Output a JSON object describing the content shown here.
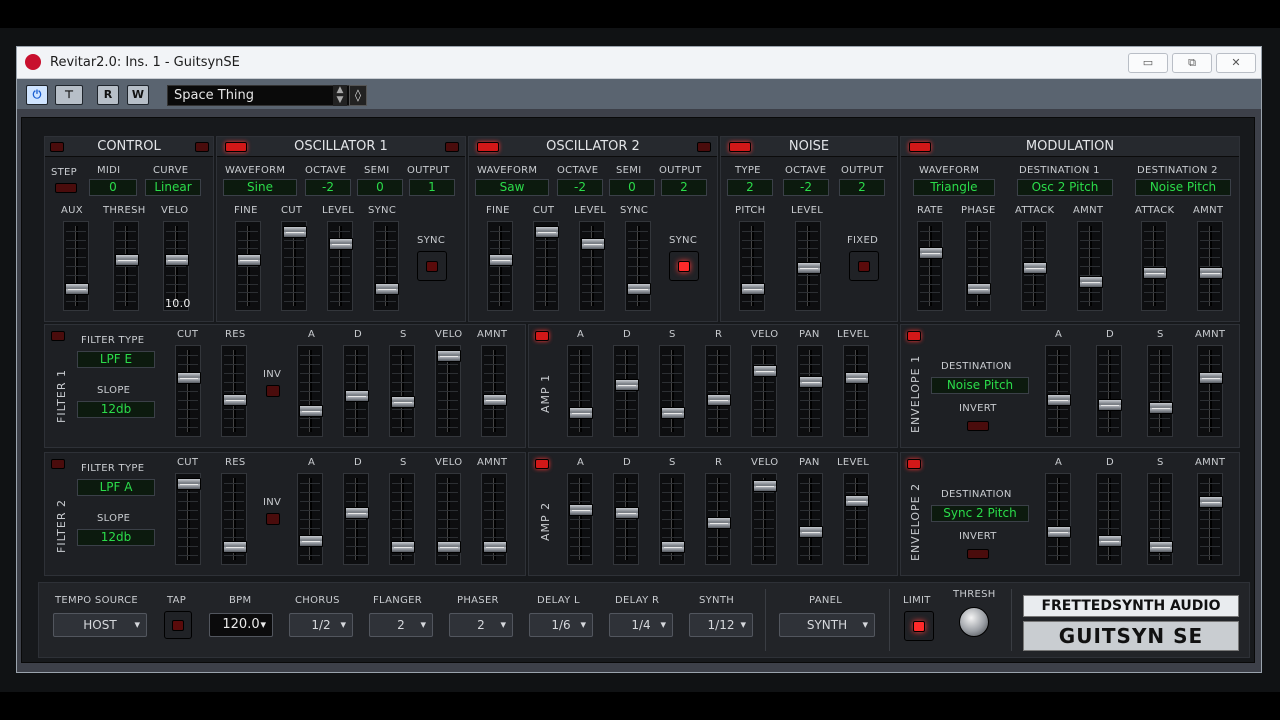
{
  "window": {
    "title": "Revitar2.0: Ins. 1 - GuitsynSE",
    "minimize": "▭",
    "restore": "⧉",
    "close": "✕"
  },
  "toolbar": {
    "power_icon": "power-icon",
    "monitor_icon": "monitor-icon",
    "read_label": "R",
    "write_label": "W",
    "preset": "Space Thing"
  },
  "control": {
    "title": "CONTROL",
    "step": "STEP",
    "midi": "MIDI",
    "curve": "CURVE",
    "midi_value": "0",
    "curve_value": "Linear",
    "aux": "AUX",
    "thresh": "THRESH",
    "velo": "VELO",
    "velo_readout": "10.0"
  },
  "osc1": {
    "title": "OSCILLATOR 1",
    "waveform": "WAVEFORM",
    "octave": "OCTAVE",
    "semi": "SEMI",
    "output": "OUTPUT",
    "waveform_value": "Sine",
    "octave_value": "-2",
    "semi_value": "0",
    "output_value": "1",
    "fine": "FINE",
    "cut": "CUT",
    "level": "LEVEL",
    "sync": "SYNC",
    "sync_btn": "SYNC"
  },
  "osc2": {
    "title": "OSCILLATOR 2",
    "waveform": "WAVEFORM",
    "octave": "OCTAVE",
    "semi": "SEMI",
    "output": "OUTPUT",
    "waveform_value": "Saw",
    "octave_value": "-2",
    "semi_value": "0",
    "output_value": "2",
    "fine": "FINE",
    "cut": "CUT",
    "level": "LEVEL",
    "sync": "SYNC",
    "sync_btn": "SYNC"
  },
  "noise": {
    "title": "NOISE",
    "type": "TYPE",
    "octave": "OCTAVE",
    "output": "OUTPUT",
    "type_value": "2",
    "octave_value": "-2",
    "output_value": "2",
    "pitch": "PITCH",
    "level": "LEVEL",
    "fixed": "FIXED"
  },
  "mod": {
    "title": "MODULATION",
    "waveform": "WAVEFORM",
    "dest1": "DESTINATION 1",
    "dest2": "DESTINATION 2",
    "waveform_value": "Triangle",
    "dest1_value": "Osc 2 Pitch",
    "dest2_value": "Noise Pitch",
    "rate": "RATE",
    "phase": "PHASE",
    "attack": "ATTACK",
    "amnt": "AMNT",
    "attack2": "ATTACK",
    "amnt2": "AMNT"
  },
  "filter1": {
    "side": "FILTER 1",
    "type_label": "FILTER TYPE",
    "type_value": "LPF E",
    "slope_label": "SLOPE",
    "slope_value": "12db",
    "cut": "CUT",
    "res": "RES",
    "inv": "INV",
    "a": "A",
    "d": "D",
    "s": "S",
    "velo": "VELO",
    "amnt": "AMNT"
  },
  "filter2": {
    "side": "FILTER 2",
    "type_label": "FILTER TYPE",
    "type_value": "LPF A",
    "slope_label": "SLOPE",
    "slope_value": "12db",
    "cut": "CUT",
    "res": "RES",
    "inv": "INV",
    "a": "A",
    "d": "D",
    "s": "S",
    "velo": "VELO",
    "amnt": "AMNT"
  },
  "amp1": {
    "side": "AMP 1",
    "a": "A",
    "d": "D",
    "s": "S",
    "r": "R",
    "velo": "VELO",
    "pan": "PAN",
    "level": "LEVEL"
  },
  "amp2": {
    "side": "AMP 2",
    "a": "A",
    "d": "D",
    "s": "S",
    "r": "R",
    "velo": "VELO",
    "pan": "PAN",
    "level": "LEVEL"
  },
  "env1": {
    "side": "ENVELOPE 1",
    "dest_label": "DESTINATION",
    "dest_value": "Noise Pitch",
    "invert": "INVERT",
    "a": "A",
    "d": "D",
    "s": "S",
    "amnt": "AMNT"
  },
  "env2": {
    "side": "ENVELOPE 2",
    "dest_label": "DESTINATION",
    "dest_value": "Sync 2 Pitch",
    "invert": "INVERT",
    "a": "A",
    "d": "D",
    "s": "S",
    "amnt": "AMNT"
  },
  "bottom": {
    "tempo_source": "TEMPO SOURCE",
    "tempo_value": "HOST",
    "tap": "TAP",
    "bpm": "BPM",
    "bpm_value": "120.0",
    "chorus": "CHORUS",
    "chorus_value": "1/2",
    "flanger": "FLANGER",
    "flanger_value": "2",
    "phaser": "PHASER",
    "phaser_value": "2",
    "delay_l": "DELAY L",
    "delay_l_value": "1/6",
    "delay_r": "DELAY R",
    "delay_r_value": "1/4",
    "synth": "SYNTH",
    "synth_value": "1/12",
    "panel": "PANEL",
    "panel_value": "SYNTH",
    "limit": "LIMIT",
    "thresh": "THRESH"
  },
  "branding": {
    "logo_top": "FRETTEDSYNTH AUDIO",
    "logo_bottom": "GUITSYN SE"
  },
  "accent_colors": {
    "display_text": "#2bdc4a",
    "led_on": "#d21818",
    "panel_bg": "#17191c"
  }
}
